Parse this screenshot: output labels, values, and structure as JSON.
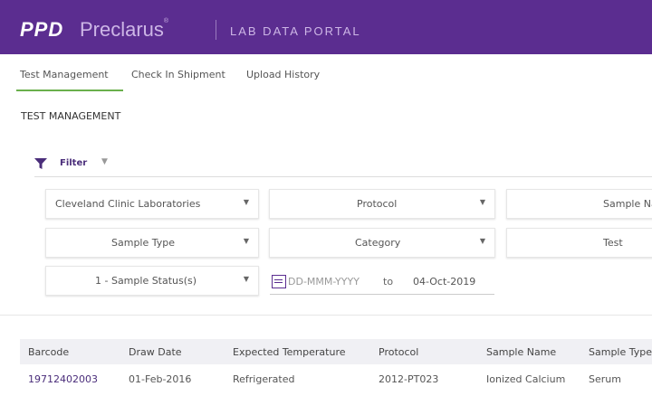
{
  "header": {
    "brand_short": "PPD",
    "brand_name": "Preclarus",
    "brand_mark": "®",
    "portal_title": "LAB DATA PORTAL"
  },
  "tabs": [
    {
      "label": "Test Management",
      "active": true
    },
    {
      "label": "Check In Shipment",
      "active": false
    },
    {
      "label": "Upload History",
      "active": false
    }
  ],
  "page_title": "TEST MANAGEMENT",
  "filter": {
    "label": "Filter",
    "lab": "Cleveland Clinic Laboratories",
    "protocol": "Protocol",
    "sample_name": "Sample Name",
    "sample_type": "Sample Type",
    "category": "Category",
    "test": "Test",
    "status": "1 - Sample Status(s)",
    "date_from_placeholder": "DD-MMM-YYYY",
    "date_to_label": "to",
    "date_to": "04-Oct-2019"
  },
  "table": {
    "columns": [
      "Barcode",
      "Draw Date",
      "Expected Temperature",
      "Protocol",
      "Sample Name",
      "Sample Type"
    ],
    "rows": [
      [
        "19712402003",
        "01-Feb-2016",
        "Refrigerated",
        "2012-PT023",
        "Ionized Calcium",
        "Serum"
      ]
    ]
  },
  "colors": {
    "header_bg": "#5b2d90",
    "accent_green": "#6ab04c",
    "link_purple": "#4a2d7a"
  }
}
